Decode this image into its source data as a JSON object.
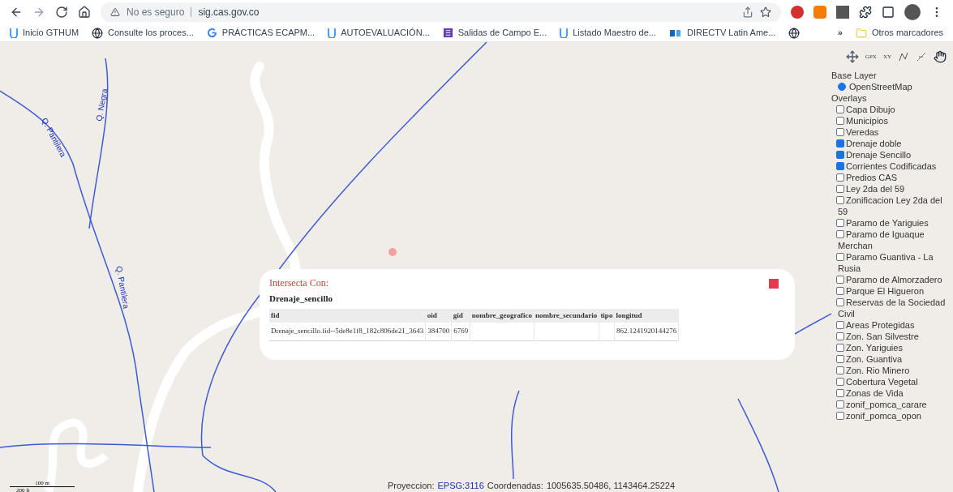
{
  "browser": {
    "security": "No es seguro",
    "url": "sig.cas.gov.co"
  },
  "bookmarks": [
    {
      "label": "Inicio GTHUM",
      "kind": "u"
    },
    {
      "label": "Consulte los proces...",
      "kind": "globe"
    },
    {
      "label": "PRÁCTICAS ECAPM...",
      "kind": "g"
    },
    {
      "label": "AUTOEVALUACIÓN...",
      "kind": "u"
    },
    {
      "label": "Salidas de Campo E...",
      "kind": "form"
    },
    {
      "label": "Listado Maestro de...",
      "kind": "u"
    },
    {
      "label": "DIRECTV Latin Ame...",
      "kind": "tv"
    },
    {
      "kind": "globe"
    }
  ],
  "more_bookmarks": "»",
  "other_bookmarks": "Otros marcadores",
  "map": {
    "labels": [
      "Q. Pantilera",
      "Q. Negra",
      "Q. Pantilera"
    ],
    "tools": [
      "GPX",
      "XY"
    ],
    "layer_switcher": {
      "base_title": "Base Layer",
      "overlays_title": "Overlays",
      "base_layers": [
        {
          "label": "OpenStreetMap",
          "selected": true
        }
      ],
      "overlays": [
        {
          "label": "Capa Dibujo",
          "checked": false
        },
        {
          "label": "Municipios",
          "checked": false
        },
        {
          "label": "Veredas",
          "checked": false
        },
        {
          "label": "Drenaje doble",
          "checked": true
        },
        {
          "label": "Drenaje Sencillo",
          "checked": true
        },
        {
          "label": "Corrientes Codificadas",
          "checked": true
        },
        {
          "label": "Predios CAS",
          "checked": false
        },
        {
          "label": "Ley 2da del 59",
          "checked": false
        },
        {
          "label": "Zonificacion Ley 2da del 59",
          "checked": false
        },
        {
          "label": "Paramo de Yariguies",
          "checked": false
        },
        {
          "label": "Paramo de Iguaque Merchan",
          "checked": false
        },
        {
          "label": "Paramo Guantiva - La Rusia",
          "checked": false
        },
        {
          "label": "Paramo de Almorzadero",
          "checked": false
        },
        {
          "label": "Parque El Higueron",
          "checked": false
        },
        {
          "label": "Reservas de la Sociedad Civil",
          "checked": false
        },
        {
          "label": "Areas Protegidas",
          "checked": false
        },
        {
          "label": "Zon. San Silvestre",
          "checked": false
        },
        {
          "label": "Zon. Yariguies",
          "checked": false
        },
        {
          "label": "Zon. Guantiva",
          "checked": false
        },
        {
          "label": "Zon. Rio Minero",
          "checked": false
        },
        {
          "label": "Cobertura Vegetal",
          "checked": false
        },
        {
          "label": "Zonas de Vida",
          "checked": false
        },
        {
          "label": "zonif_pomca_carare",
          "checked": false
        },
        {
          "label": "zonif_pomca_opon",
          "checked": false
        }
      ]
    }
  },
  "popup": {
    "title": "Intersecta Con:",
    "layer": "Drenaje_sencillo",
    "columns": [
      "fid",
      "oid",
      "gid",
      "nombre_geografico",
      "nombre_secundario",
      "tipo",
      "longitud"
    ],
    "rows": [
      [
        "Drenaje_sencillo.fid--5de8e1f8_182c806de21_3643",
        "384700",
        "6769",
        "",
        "",
        "",
        "862.1241920144276"
      ]
    ]
  },
  "scale": {
    "metric": "100 m",
    "imperial": "200 ft"
  },
  "footer": {
    "projection_label": "Proyeccion:",
    "projection": "EPSG:3116",
    "coords_label": "Coordenadas:",
    "coords": "1005635.50486, 1143464.25224"
  }
}
